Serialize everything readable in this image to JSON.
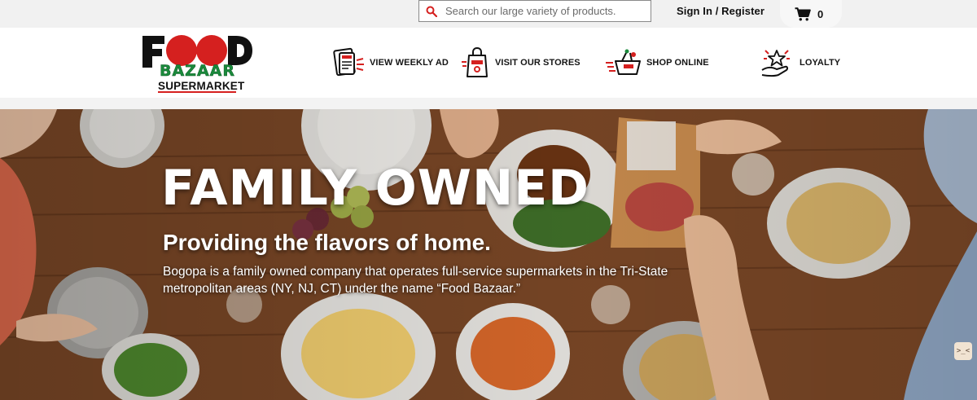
{
  "topbar": {
    "search": {
      "placeholder": "Search our large variety of products.",
      "value": ""
    },
    "signin_label": "Sign In / Register",
    "cart": {
      "icon": "cart-icon",
      "count": "0"
    }
  },
  "header": {
    "logo": {
      "line1": "FOOD",
      "line2": "BAZAAR",
      "line3": "SUPERMARKET"
    },
    "nav": [
      {
        "label": "VIEW WEEKLY AD",
        "icon": "weekly-ad-icon"
      },
      {
        "label": "VISIT OUR STORES",
        "icon": "store-bag-icon"
      },
      {
        "label": "SHOP ONLINE",
        "icon": "shopping-basket-icon"
      },
      {
        "label": "LOYALTY",
        "icon": "loyalty-hand-star-icon"
      }
    ]
  },
  "hero": {
    "title": "FAMILY OWNED",
    "subtitle": "Providing the flavors of home.",
    "body": "Bogopa is a family owned company that operates full-service supermarkets in the Tri-State metropolitan areas (NY, NJ, CT) under the name “Food Bazaar.”"
  },
  "chat": {
    "glyph": ">_<"
  },
  "colors": {
    "brand_red": "#d5201f",
    "brand_green": "#1a8a3c",
    "brand_black": "#111111",
    "topbar_bg": "#f1f1f1"
  }
}
